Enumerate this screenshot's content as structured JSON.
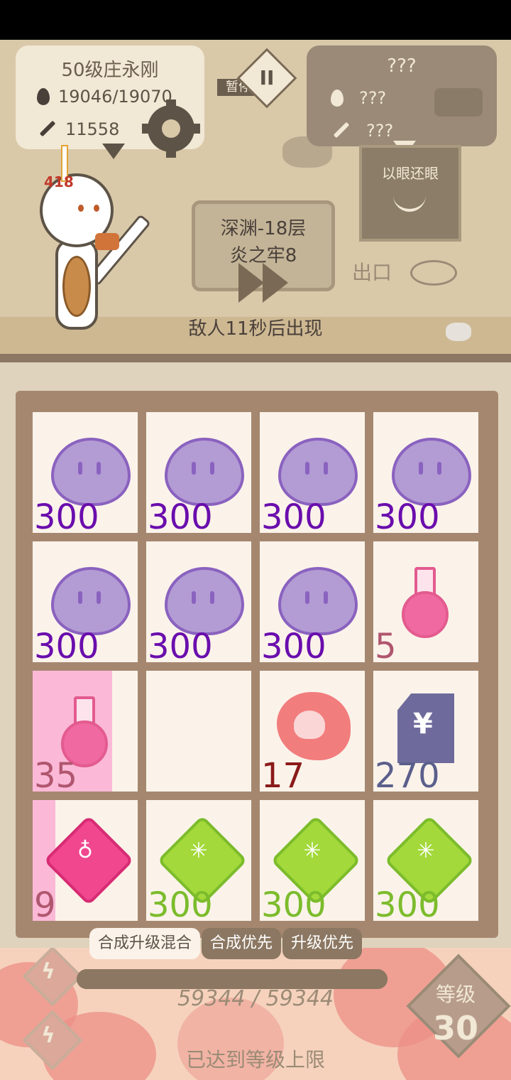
{
  "player": {
    "title": "50级庄永刚",
    "hp": "19046/19070",
    "attack": "11558",
    "hp_above_head": "418"
  },
  "pause_label": "暂停",
  "pause_symbol": "II",
  "enemy": {
    "title": "???",
    "hp": "???",
    "attack": "???"
  },
  "poster_label": "以眼还眼",
  "floor": {
    "line1": "深渊-18层",
    "line2": "炎之牢8"
  },
  "exit_label": "出口",
  "enemy_timer": "敌人11秒后出现",
  "grid": [
    {
      "type": "slime",
      "value": "300",
      "color": "#6a0dad"
    },
    {
      "type": "slime",
      "value": "300",
      "color": "#6a0dad"
    },
    {
      "type": "slime",
      "value": "300",
      "color": "#6a0dad"
    },
    {
      "type": "slime",
      "value": "300",
      "color": "#6a0dad"
    },
    {
      "type": "slime",
      "value": "300",
      "color": "#6a0dad"
    },
    {
      "type": "slime",
      "value": "300",
      "color": "#6a0dad"
    },
    {
      "type": "slime",
      "value": "300",
      "color": "#6a0dad"
    },
    {
      "type": "potion",
      "value": "5",
      "color": "#b0566f"
    },
    {
      "type": "potion-selected",
      "value": "35",
      "color": "#b0566f"
    },
    {
      "type": "empty",
      "value": "",
      "color": "#000000"
    },
    {
      "type": "poison",
      "value": "17",
      "color": "#8b1a1a"
    },
    {
      "type": "money",
      "value": "270",
      "color": "#5b5f8c"
    },
    {
      "type": "pink-gem",
      "value": "9",
      "color": "#b0566f"
    },
    {
      "type": "green-gem",
      "value": "300",
      "color": "#7cbc2c"
    },
    {
      "type": "green-gem",
      "value": "300",
      "color": "#7cbc2c"
    },
    {
      "type": "green-gem",
      "value": "300",
      "color": "#7cbc2c"
    }
  ],
  "tabs": [
    {
      "label": "合成升级混合",
      "active": true
    },
    {
      "label": "合成优先",
      "active": false
    },
    {
      "label": "升级优先",
      "active": false
    }
  ],
  "xp": {
    "text": "59344 / 59344",
    "fill": 1.0
  },
  "level": {
    "label": "等级",
    "value": "30"
  },
  "max_level_text": "已达到等级上限"
}
